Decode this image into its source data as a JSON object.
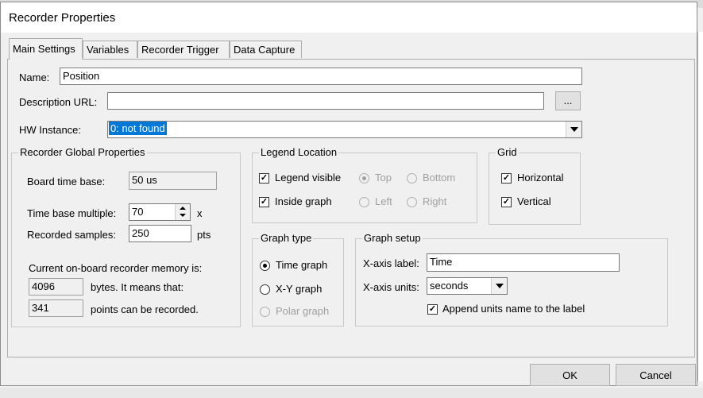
{
  "dialog": {
    "title": "Recorder Properties"
  },
  "tabs": [
    "Main Settings",
    "Variables",
    "Recorder Trigger",
    "Data Capture"
  ],
  "main": {
    "name_label": "Name:",
    "name_value": "Position",
    "desc_label": "Description URL:",
    "desc_value": "",
    "browse_label": "...",
    "hw_label": "HW Instance:",
    "hw_value": "0: not found"
  },
  "global": {
    "title": "Recorder Global Properties",
    "timebase_label": "Board time base:",
    "timebase_value": "50 us",
    "multiple_label": "Time base multiple:",
    "multiple_value": "70",
    "multiple_unit": "x",
    "samples_label": "Recorded samples:",
    "samples_value": "250",
    "samples_unit": "pts",
    "memory_label": "Current on-board recorder memory is:",
    "bytes_value": "4096",
    "bytes_text": "bytes. It means that:",
    "points_value": "341",
    "points_text": "points can be recorded."
  },
  "legend": {
    "title": "Legend Location",
    "visible_label": "Legend visible",
    "inside_label": "Inside graph",
    "top_label": "Top",
    "bottom_label": "Bottom",
    "left_label": "Left",
    "right_label": "Right"
  },
  "grid": {
    "title": "Grid",
    "horizontal_label": "Horizontal",
    "vertical_label": "Vertical"
  },
  "graph_type": {
    "title": "Graph type",
    "time_label": "Time graph",
    "xy_label": "X-Y graph",
    "polar_label": "Polar graph"
  },
  "graph_setup": {
    "title": "Graph setup",
    "xlabel_label": "X-axis label:",
    "xlabel_value": "Time",
    "xunits_label": "X-axis units:",
    "xunits_value": "seconds",
    "append_label": "Append units name to the label"
  },
  "buttons": {
    "ok": "OK",
    "cancel": "Cancel"
  },
  "colors": {
    "selection": "#0078d7",
    "window_bg": "#f0f0f0"
  }
}
